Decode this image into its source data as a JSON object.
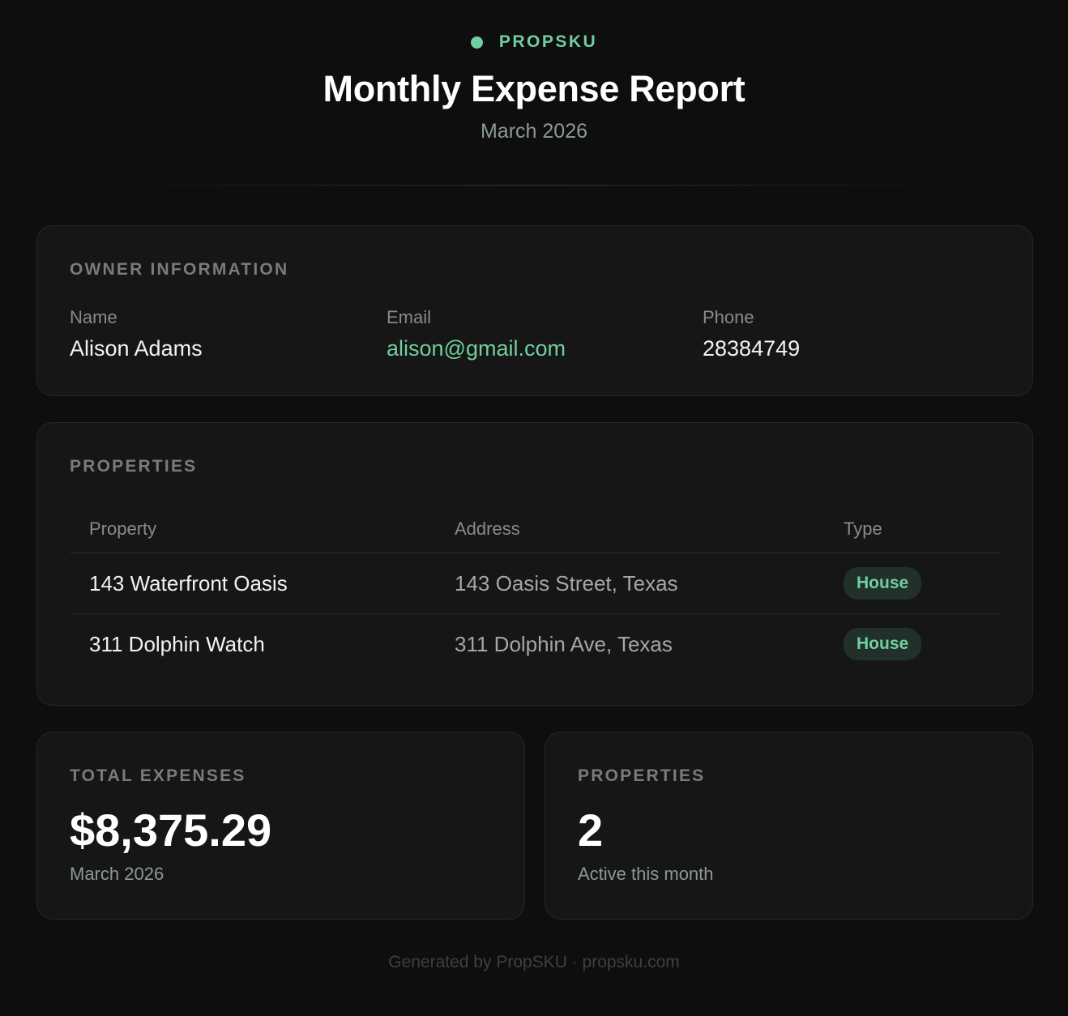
{
  "brand": {
    "name": "PROPSKU"
  },
  "header": {
    "title": "Monthly Expense Report",
    "period": "March 2026"
  },
  "owner": {
    "section_label": "OWNER INFORMATION",
    "name_label": "Name",
    "name": "Alison Adams",
    "email_label": "Email",
    "email": "alison@gmail.com",
    "phone_label": "Phone",
    "phone": "28384749"
  },
  "properties": {
    "section_label": "PROPERTIES",
    "columns": [
      "Property",
      "Address",
      "Type"
    ],
    "rows": [
      {
        "property": "143 Waterfront Oasis",
        "address": "143 Oasis Street, Texas",
        "type": "House"
      },
      {
        "property": "311 Dolphin Watch",
        "address": "311 Dolphin Ave, Texas",
        "type": "House"
      }
    ]
  },
  "stats": {
    "total": {
      "label": "TOTAL EXPENSES",
      "value": "$8,375.29",
      "sub": "March 2026"
    },
    "count": {
      "label": "PROPERTIES",
      "value": "2",
      "sub": "Active this month"
    }
  },
  "footer": {
    "text": "Generated by PropSKU · propsku.com"
  },
  "colors": {
    "accent": "#6fcf9f",
    "background": "#0e0e0e",
    "card": "#161616"
  }
}
